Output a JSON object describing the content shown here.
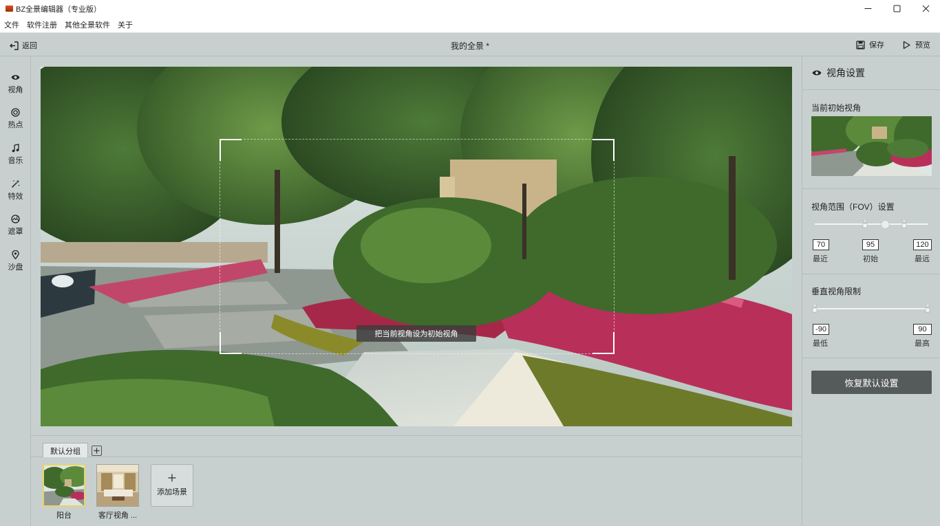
{
  "window": {
    "title": "BZ全景编辑器（专业版）",
    "controls": [
      "minimize-icon",
      "maximize-icon",
      "close-icon"
    ]
  },
  "menu": {
    "items": [
      "文件",
      "软件注册",
      "其他全景软件",
      "关于"
    ]
  },
  "toolbar": {
    "back_label": "返回",
    "page_title": "我的全景 *",
    "save_label": "保存",
    "preview_label": "预览"
  },
  "sidebar": {
    "items": [
      {
        "label": "视角",
        "icon": "eye-icon"
      },
      {
        "label": "热点",
        "icon": "target-icon"
      },
      {
        "label": "音乐",
        "icon": "music-icon"
      },
      {
        "label": "特效",
        "icon": "magic-wand-icon"
      },
      {
        "label": "遮罩",
        "icon": "mask-icon"
      },
      {
        "label": "沙盘",
        "icon": "map-pin-icon"
      }
    ]
  },
  "viewer": {
    "set_initial_view_label": "把当前视角设为初始视角"
  },
  "panel": {
    "title": "视角设置",
    "current_view_title": "当前初始视角",
    "fov": {
      "title": "视角范围（FOV）设置",
      "min_value": "70",
      "init_value": "95",
      "max_value": "120",
      "min_label": "最近",
      "init_label": "初始",
      "max_label": "最远"
    },
    "vertical": {
      "title": "垂直视角限制",
      "min_value": "-90",
      "max_value": "90",
      "min_label": "最低",
      "max_label": "最高"
    },
    "reset_label": "恢复默认设置"
  },
  "scenes": {
    "group_tab": "默认分组",
    "items": [
      {
        "label": "阳台",
        "active": true
      },
      {
        "label": "客厅视角 ..."
      }
    ],
    "add_label": "添加场景"
  },
  "colors": {
    "background": "#c7d0cf",
    "reset_button": "#555b5b",
    "active_scene_border": "#e9d36a"
  }
}
